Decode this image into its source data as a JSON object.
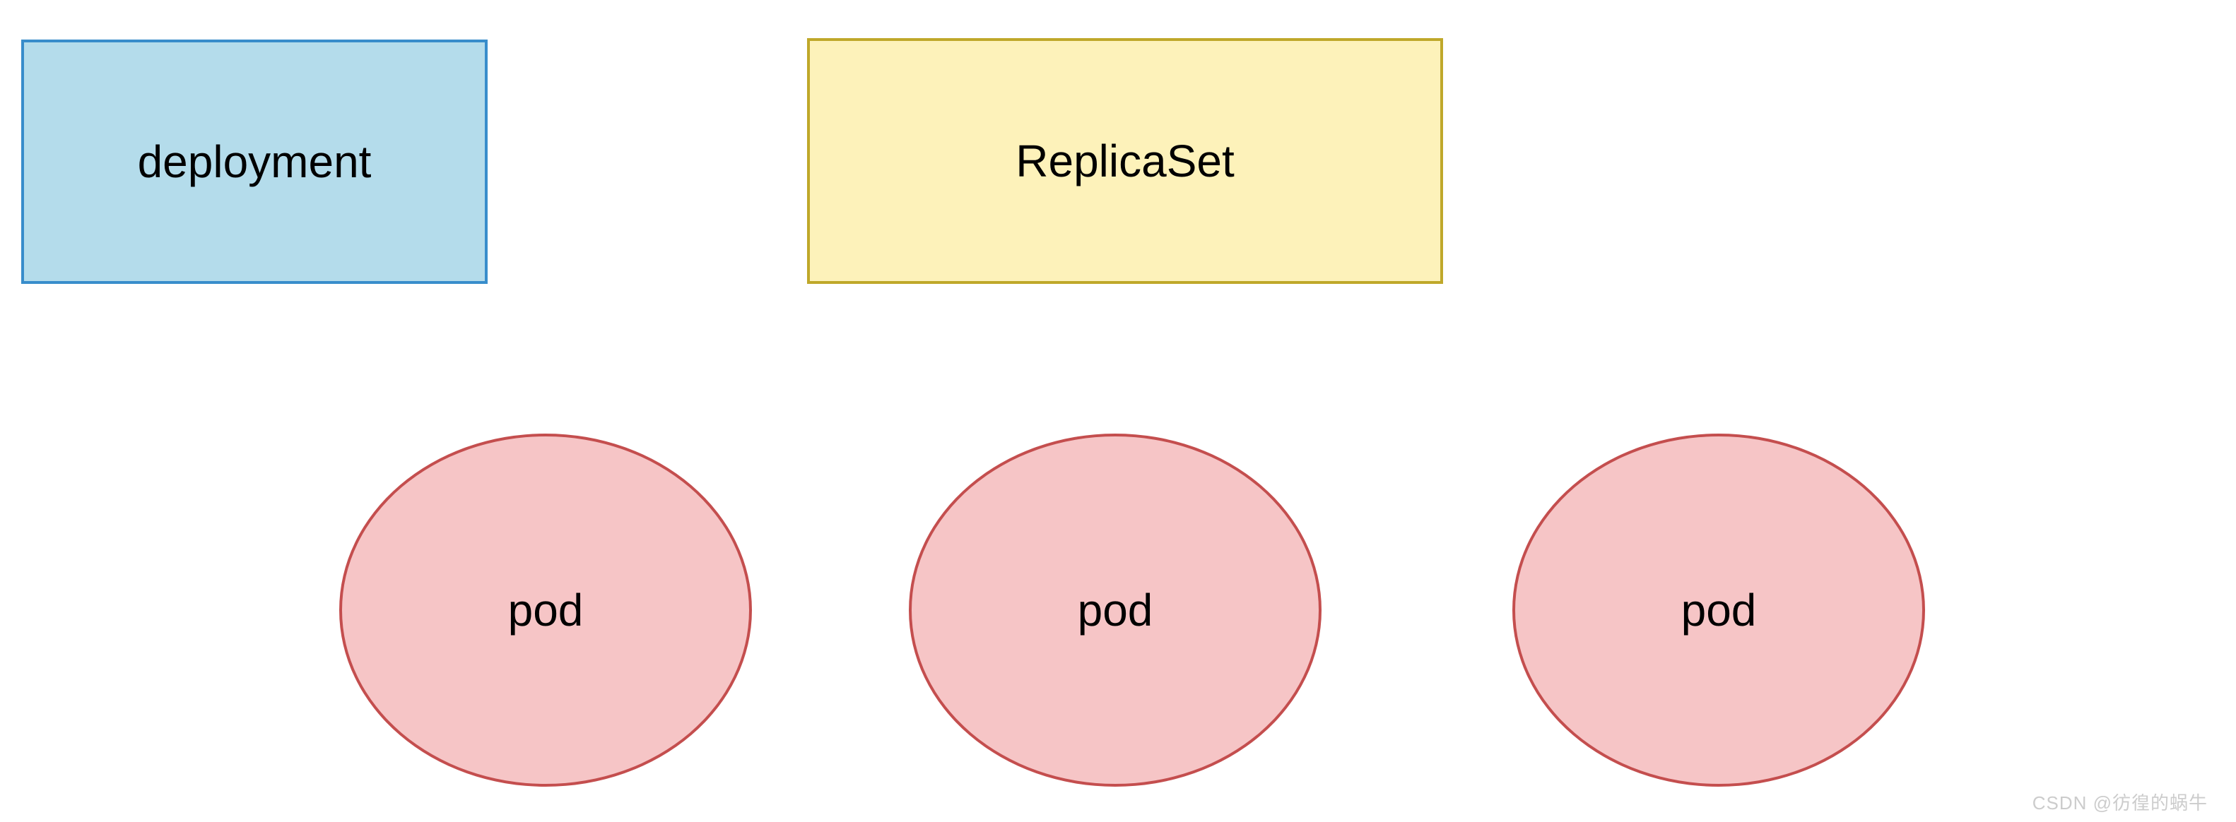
{
  "diagram": {
    "deployment": {
      "label": "deployment"
    },
    "replicaset": {
      "label": "ReplicaSet"
    },
    "pods": [
      {
        "label": "pod"
      },
      {
        "label": "pod"
      },
      {
        "label": "pod"
      }
    ]
  },
  "watermark": "CSDN @彷徨的蜗牛",
  "colors": {
    "deployment_bg": "#b4dceb",
    "deployment_border": "#388dcb",
    "replicaset_bg": "#fdf2ba",
    "replicaset_border": "#bfa82a",
    "pod_bg": "#f6c5c6",
    "pod_border": "#c44e4e"
  }
}
